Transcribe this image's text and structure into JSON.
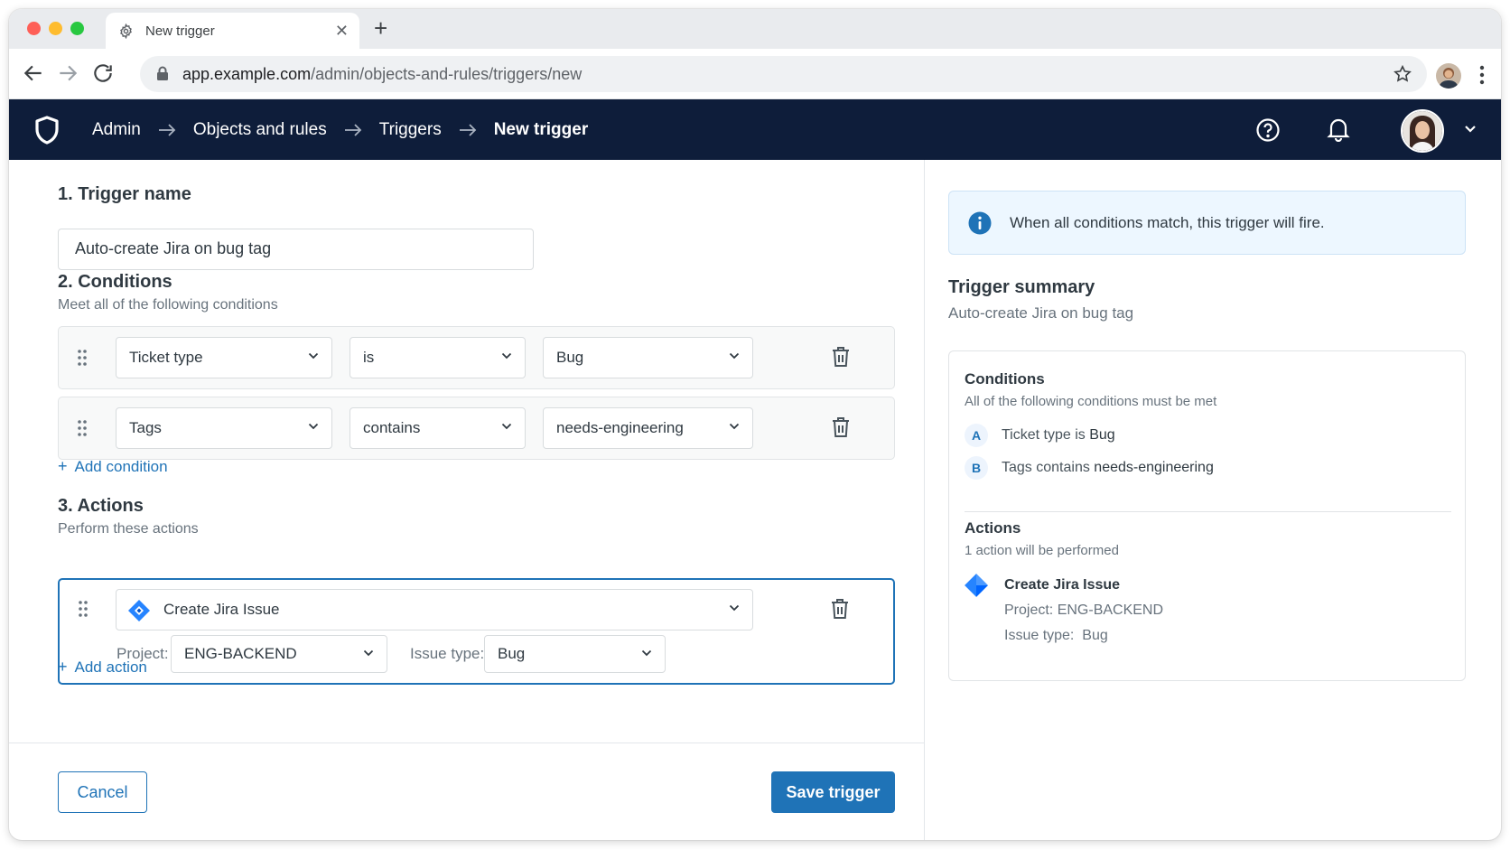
{
  "browser": {
    "tab_title": "New trigger",
    "url_host": "app.example.com",
    "url_path": "/admin/objects-and-rules/triggers/new"
  },
  "header": {
    "breadcrumbs": [
      "Admin",
      "Objects and rules",
      "Triggers",
      "New trigger"
    ]
  },
  "form": {
    "section1_title": "1. Trigger name",
    "trigger_name": "Auto-create Jira on bug tag",
    "section2_title": "2. Conditions",
    "section2_sub": "Meet all of the following conditions",
    "conditions": [
      {
        "field": "Ticket type",
        "operator": "is",
        "value": "Bug"
      },
      {
        "field": "Tags",
        "operator": "contains",
        "value": "needs-engineering"
      }
    ],
    "add_condition": "Add condition",
    "section3_title": "3. Actions",
    "section3_sub": "Perform these actions",
    "action": {
      "type": "Create Jira Issue",
      "project_label": "Project:",
      "project_value": "ENG-BACKEND",
      "issue_type_label": "Issue type:",
      "issue_type_value": "Bug"
    },
    "add_action": "Add action",
    "cancel": "Cancel",
    "save": "Save trigger"
  },
  "summary": {
    "info_text": "When all conditions match, this trigger will fire.",
    "title": "Trigger summary",
    "name": "Auto-create Jira on bug tag",
    "conditions_title": "Conditions",
    "conditions_sub": "All of the following conditions must be met",
    "conditions": [
      {
        "letter": "A",
        "field": "Ticket type",
        "operator": "is",
        "value": "Bug"
      },
      {
        "letter": "B",
        "field": "Tags",
        "operator": "contains",
        "value": "needs-engineering"
      }
    ],
    "actions_title": "Actions",
    "actions_sub": "1 action will be performed",
    "action_name": "Create Jira Issue",
    "action_project": "Project: ENG-BACKEND",
    "action_issue_type": "Issue type:  Bug"
  },
  "colors": {
    "header_bg": "#0e1d3a",
    "primary": "#1f73b7",
    "jira": "#2684ff"
  }
}
